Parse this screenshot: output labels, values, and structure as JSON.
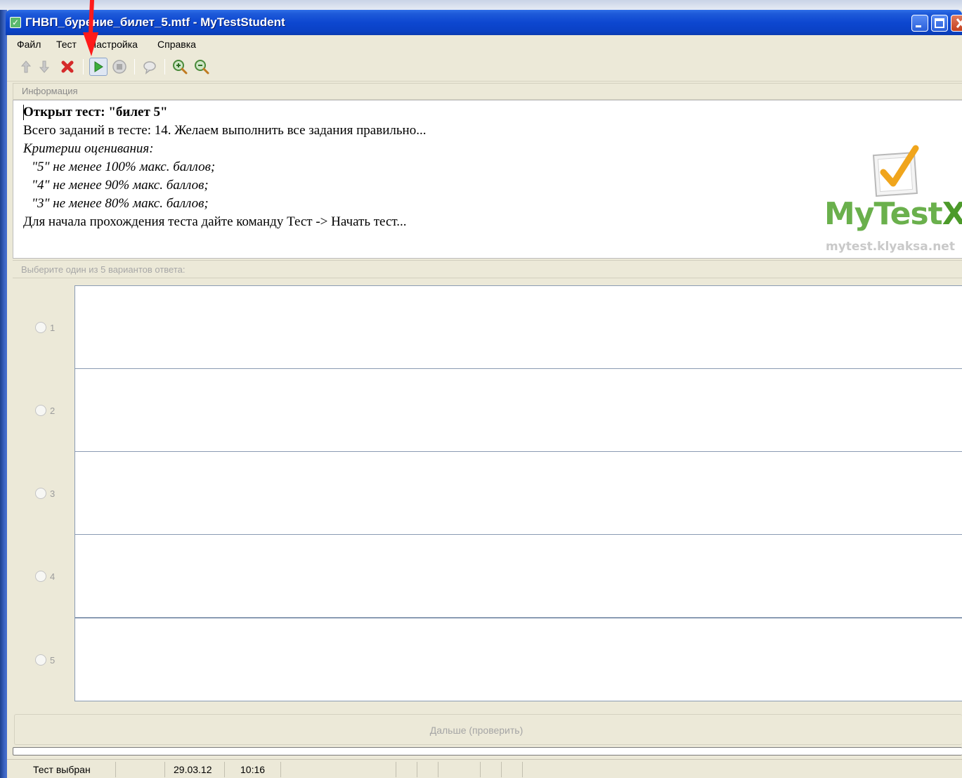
{
  "window": {
    "title": "ГНВП_бурение_билет_5.mtf - MyTestStudent",
    "title_icon": "check-icon"
  },
  "menu": {
    "items": [
      {
        "label": "Файл"
      },
      {
        "label": "Тест"
      },
      {
        "label": "Настройка"
      },
      {
        "label": "Справка"
      }
    ]
  },
  "toolbar": {
    "buttons": [
      {
        "icon": "up-arrow-icon",
        "enabled": false
      },
      {
        "icon": "down-arrow-icon",
        "enabled": false
      },
      {
        "icon": "close-x-icon",
        "enabled": true,
        "color": "#d52a2a"
      },
      {
        "icon": "play-icon",
        "enabled": true,
        "color": "#3cae3c",
        "highlighted": true
      },
      {
        "icon": "stop-icon",
        "enabled": false
      },
      {
        "icon": "speech-bubble-icon",
        "enabled": false
      },
      {
        "icon": "zoom-in-icon",
        "enabled": true
      },
      {
        "icon": "zoom-out-icon",
        "enabled": true
      }
    ]
  },
  "info": {
    "header": "Информация",
    "title": "Открыт тест: \"билет 5\"",
    "total": "Всего заданий в тесте: 14. Желаем выполнить все задания правильно...",
    "criteria_label": "Критерии оценивания:",
    "criteria": [
      "\"5\" не менее 100% макс. баллов;",
      "\"4\" не менее 90% макс. баллов;",
      "\"3\" не менее 80% макс. баллов;"
    ],
    "start_hint": "Для начала прохождения теста дайте команду Тест -> Начать тест..."
  },
  "logo": {
    "name_part1": "MyTest",
    "name_part2": "X",
    "url": "mytest.klyaksa.net",
    "color_green": "#6ab04c",
    "color_x": "#4c9a2a"
  },
  "answers": {
    "header": "Выберите один из 5 вариантов ответа:",
    "options": [
      {
        "number": "1",
        "text": ""
      },
      {
        "number": "2",
        "text": ""
      },
      {
        "number": "3",
        "text": ""
      },
      {
        "number": "4",
        "text": ""
      },
      {
        "number": "5",
        "text": ""
      }
    ]
  },
  "next_button": {
    "label": "Дальше (проверить)",
    "enabled": false
  },
  "progress": {
    "value": 0
  },
  "statusbar": {
    "status": "Тест выбран",
    "date": "29.03.12",
    "time": "10:16"
  },
  "colors": {
    "titlebar": "#0d47d0",
    "window_bg": "#ece9d8",
    "annotation_arrow": "#ff1a1a"
  }
}
